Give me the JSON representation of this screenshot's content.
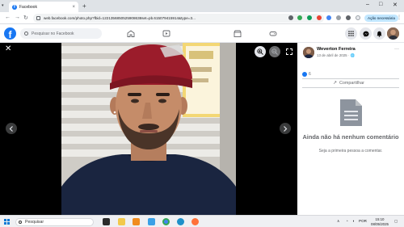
{
  "browser": {
    "tab_title": "Facebook",
    "new_tab": "+",
    "url": "web.facebook.com/photo.php?fbid=1221356850525908638set=pb.615079415914&type=3...",
    "action_button": "Ação necessária",
    "window_controls": [
      "–",
      "□",
      "✕"
    ]
  },
  "facebook": {
    "logo": "f",
    "search_placeholder": "Pesquisar no Facebook",
    "nav_icons": [
      "home-icon",
      "video-icon",
      "marketplace-icon",
      "gaming-icon"
    ],
    "right_icons": [
      "menu-grid-icon",
      "messenger-icon",
      "bell-icon"
    ]
  },
  "post": {
    "author": "Weverton Ferreira",
    "date": "13 de abril de 2025 · 🌐",
    "reaction_count": "6",
    "share_label": "Compartilhar",
    "empty_title": "Ainda não há nenhum comentário",
    "empty_subtitle": "Seja a primeira pessoa a comentar."
  },
  "taskbar": {
    "search_placeholder": "Pesquisar",
    "tray_language": "POR",
    "time": "15:10",
    "date": "08/05/2025"
  },
  "colors": {
    "facebook_blue": "#1877f2",
    "viewer_bg": "#000000",
    "cap_red": "#9b1c2b",
    "shirt_navy": "#1a2540"
  }
}
